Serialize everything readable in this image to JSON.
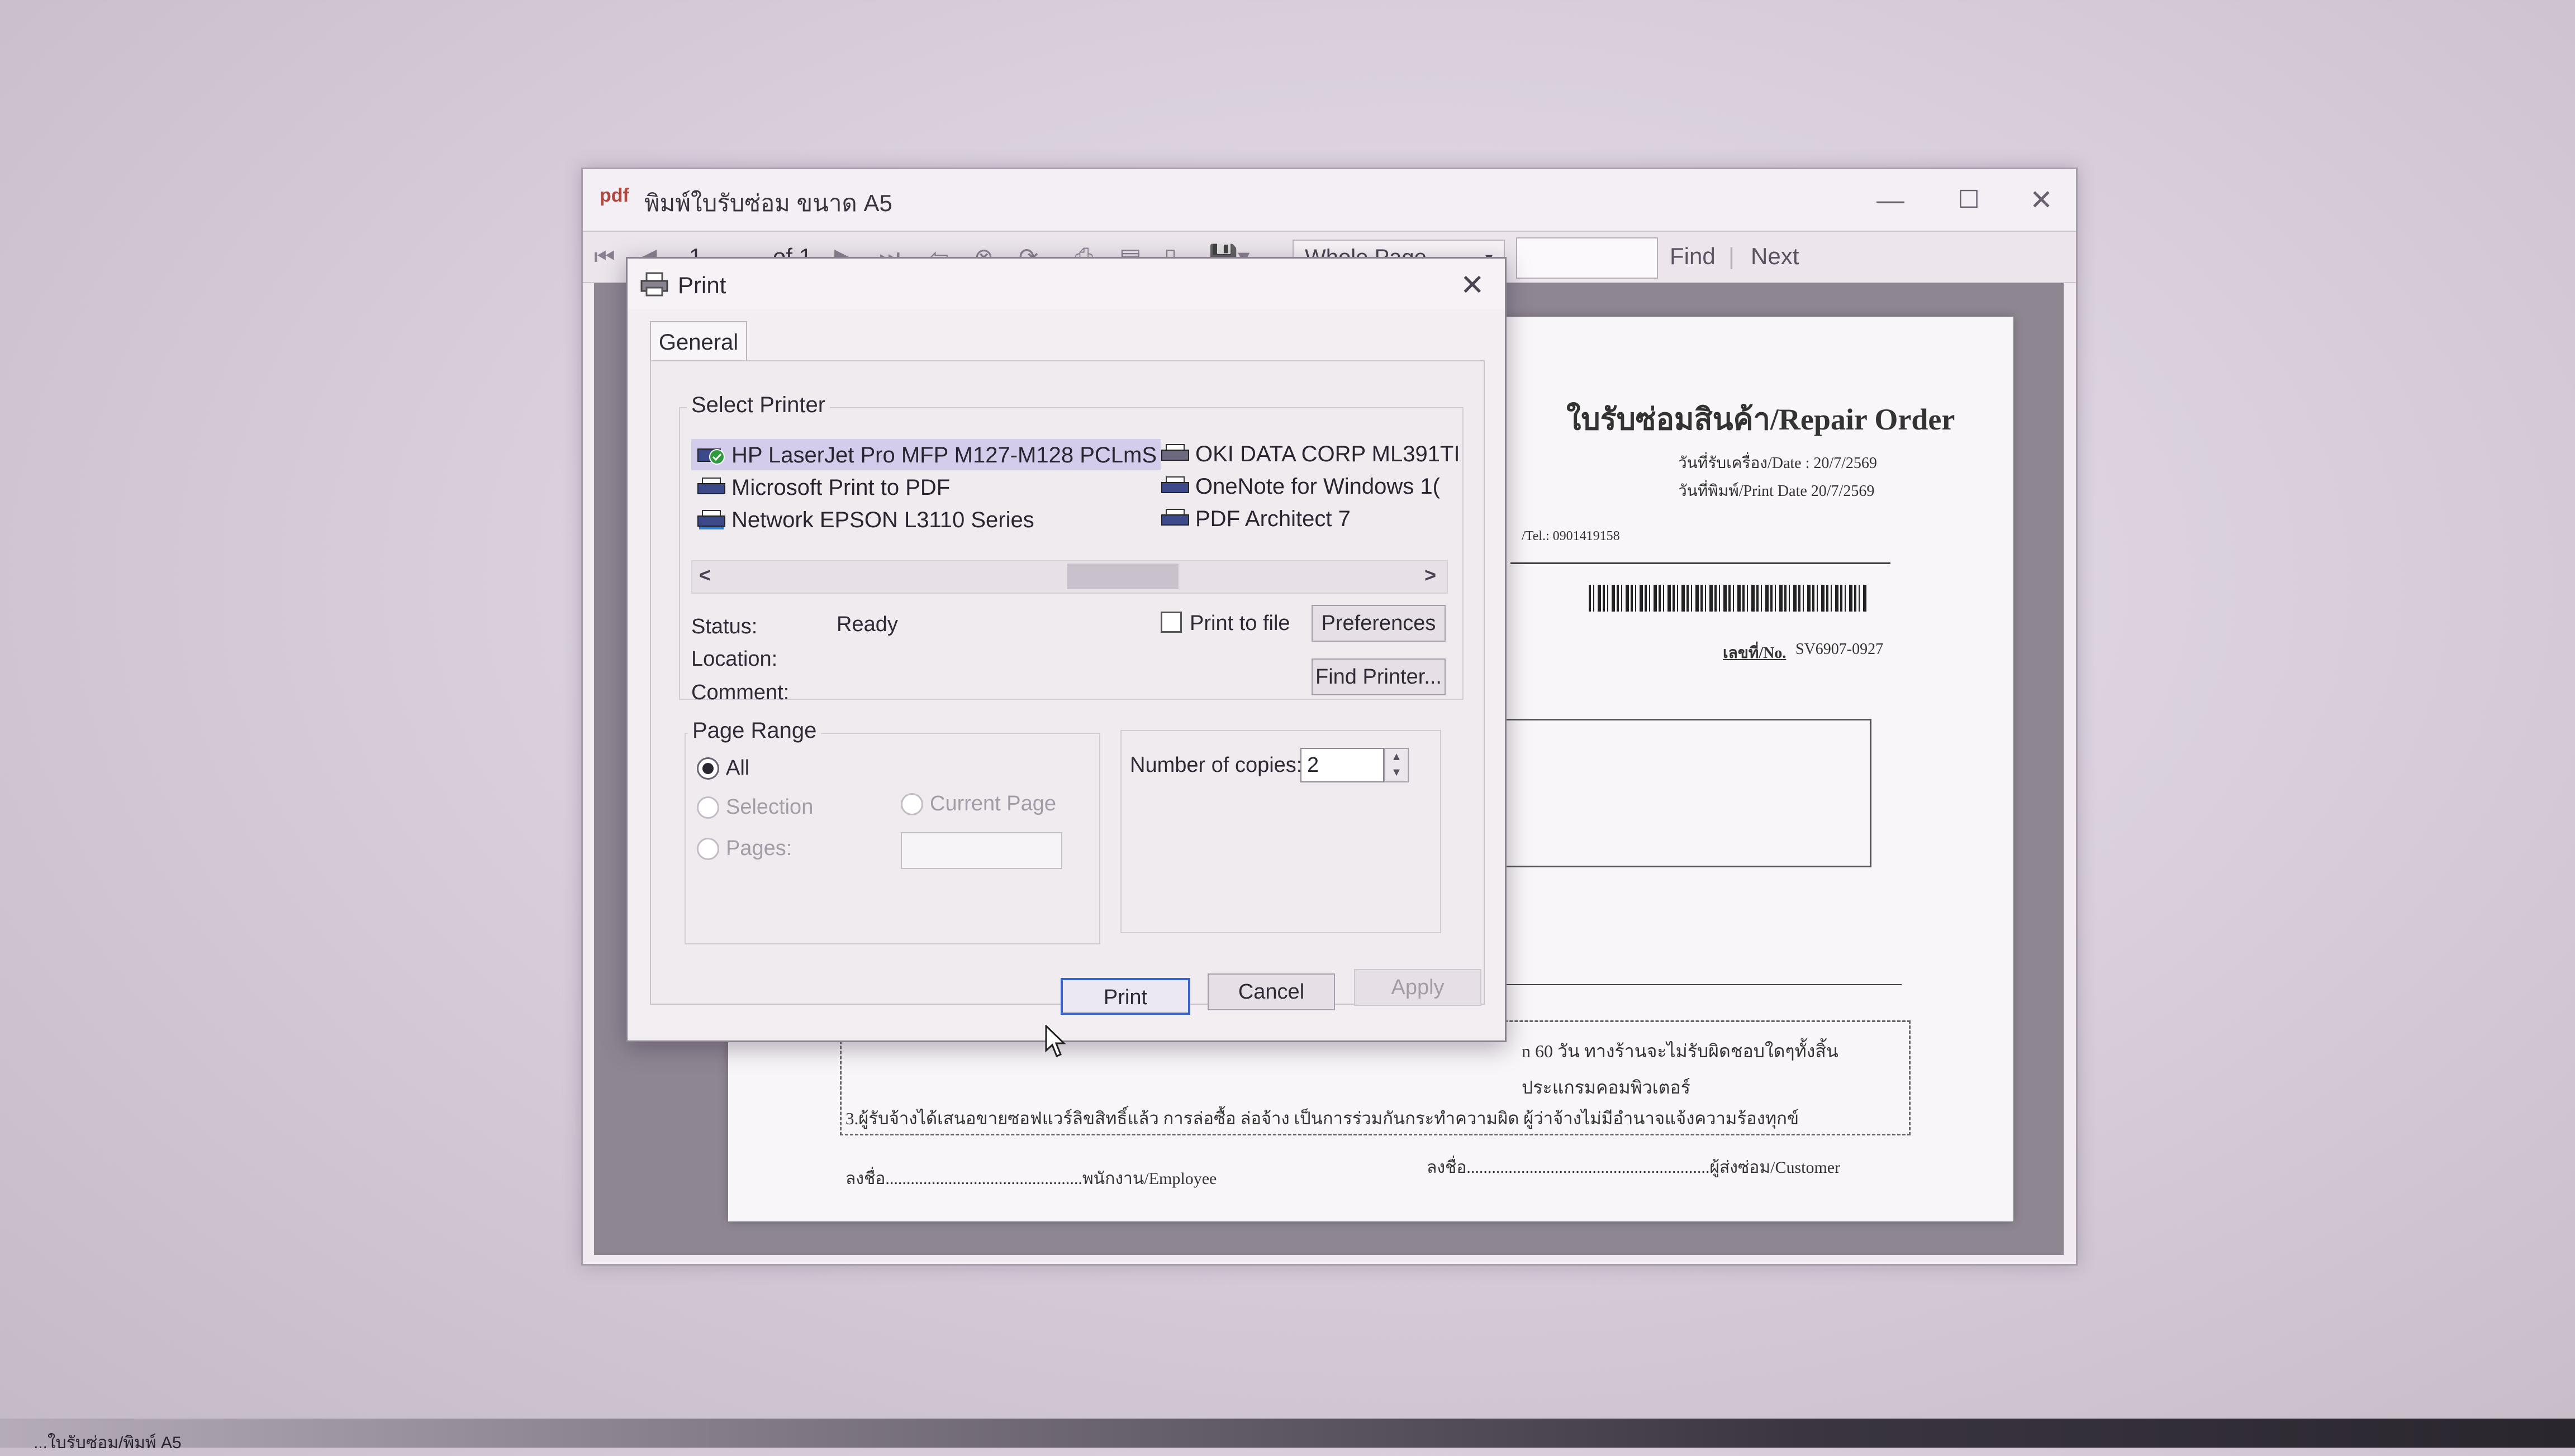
{
  "window": {
    "title": "พิมพ์ใบรับซ่อม ขนาด A5",
    "app_icon": "pdf",
    "controls": {
      "minimize": "—",
      "maximize": "☐",
      "close": "✕"
    }
  },
  "toolbar": {
    "page_current": "1",
    "page_of": "of 1",
    "zoom": "Whole Page",
    "find_label": "Find",
    "next_label": "Next"
  },
  "document": {
    "title": "ใบรับซ่อมสินค้า/Repair Order",
    "received_date": "วันที่รับเครื่อง/Date : 20/7/2569",
    "print_date": "วันที่พิมพ์/Print Date 20/7/2569",
    "tel": "/Tel.: 0901419158",
    "number_label": "เลขที่/No.",
    "number": "SV6907-0927",
    "term1": "n 60 วัน ทางร้านจะไม่รับผิดชอบใดๆทั้งสิ้น",
    "term2": "ประแกรมคอมพิวเตอร์",
    "term3": "3.ผู้รับจ้างได้เสนอขายซอฟแวร์ลิขสิทธิ์แล้ว การล่อซื้อ ล่อจ้าง เป็นการร่วมกันกระทำความผิด ผู้ว่าจ้างไม่มีอำนาจแจ้งความร้องทุกข์",
    "sign_employee": "ลงชื่อ...............................................พนักงาน/Employee",
    "sign_customer": "ลงชื่อ..........................................................ผู้ส่งซ่อม/Customer"
  },
  "dialog": {
    "title": "Print",
    "close": "✕",
    "tab": "General",
    "select_printer_label": "Select Printer",
    "printers": [
      {
        "name": "HP LaserJet Pro MFP M127-M128 PCLmS",
        "selected": true,
        "default": true
      },
      {
        "name": "Microsoft Print to PDF",
        "selected": false
      },
      {
        "name": "Network EPSON L3110 Series",
        "selected": false
      },
      {
        "name": "OKI DATA CORP ML391TI",
        "selected": false
      },
      {
        "name": "OneNote for Windows 1(",
        "selected": false
      },
      {
        "name": "PDF Architect 7",
        "selected": false
      }
    ],
    "scroll_left": "<",
    "scroll_right": ">",
    "status_label": "Status:",
    "status_value": "Ready",
    "location_label": "Location:",
    "comment_label": "Comment:",
    "print_to_file_label": "Print to file",
    "print_to_file_checked": false,
    "preferences_button": "Preferences",
    "find_printer_button": "Find Printer...",
    "page_range_label": "Page Range",
    "range_all": "All",
    "range_selection": "Selection",
    "range_current_page": "Current Page",
    "range_pages": "Pages:",
    "range_selected": "All",
    "copies_label": "Number of copies:",
    "copies_value": "2",
    "print_button": "Print",
    "cancel_button": "Cancel",
    "apply_button": "Apply"
  },
  "taskbar": {
    "left_text": "...ใบรับซ่อม/พิมพ์ A5"
  },
  "colors": {
    "selection": "#d3ccea",
    "default_check": "#2e9b3e",
    "focus_border": "#3a63c9"
  }
}
